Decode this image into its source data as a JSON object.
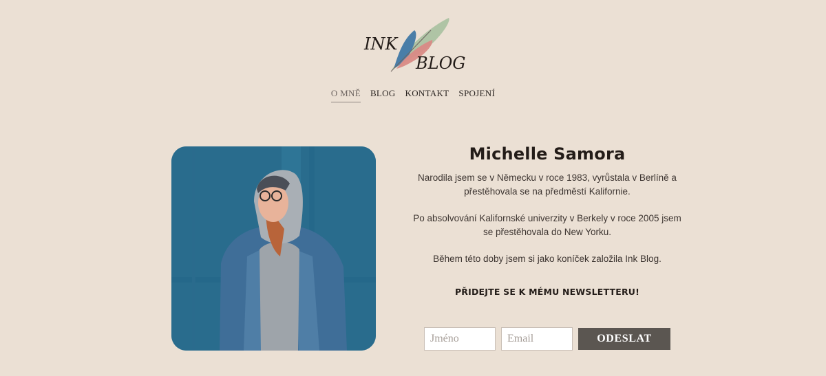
{
  "brand": {
    "logo_line1": "INK",
    "logo_line2": "BLOG",
    "feather_colors": [
      "#a9c1a0",
      "#4a7ea8",
      "#d98a85"
    ]
  },
  "nav": {
    "items": [
      {
        "label": "O MNĚ",
        "active": true
      },
      {
        "label": "BLOG",
        "active": false
      },
      {
        "label": "KONTAKT",
        "active": false
      },
      {
        "label": "SPOJENÍ",
        "active": false
      }
    ]
  },
  "profile": {
    "name": "Michelle Samora",
    "bio": [
      "Narodila jsem se v Německu v roce 1983, vyrůstala v Berlíně a přestěhovala se na předměstí Kalifornie.",
      "Po absolvování Kalifornské univerzity v Berkely v roce 2005 jsem se přestěhovala do New Yorku.",
      "Během této doby jsem si jako koníček založila Ink Blog."
    ],
    "photo_bg_color": "#2c7092"
  },
  "newsletter": {
    "heading": "PŘIDEJTE SE K MÉMU NEWSLETTERU!",
    "name_placeholder": "Jméno",
    "email_placeholder": "Email",
    "submit_label": "ODESLAT"
  }
}
